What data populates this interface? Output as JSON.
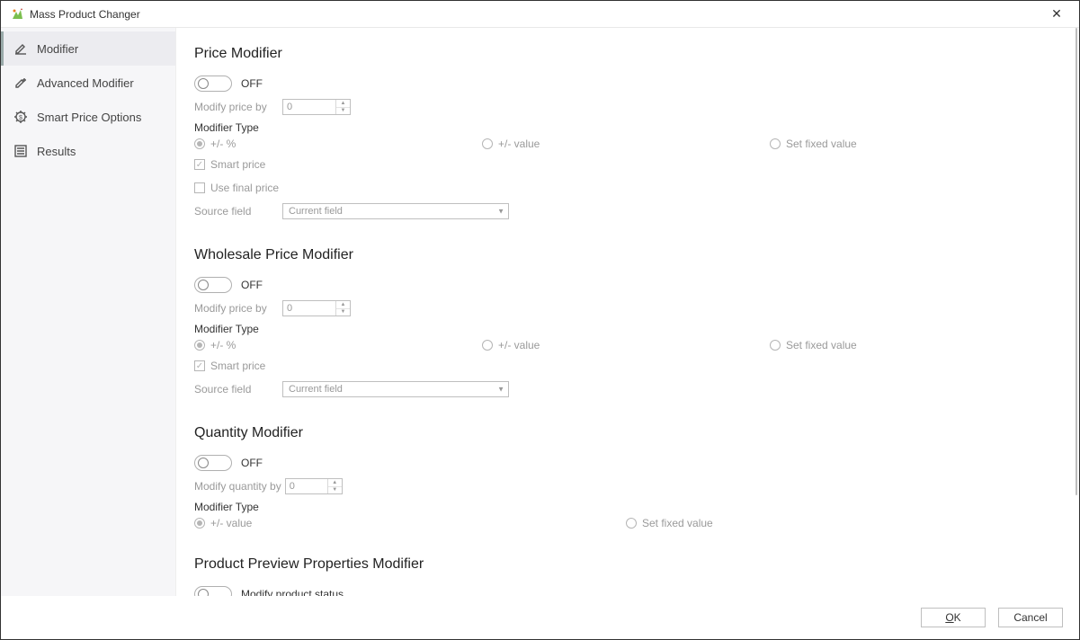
{
  "window": {
    "title": "Mass Product Changer"
  },
  "sidebar": {
    "items": [
      {
        "label": "Modifier"
      },
      {
        "label": "Advanced Modifier"
      },
      {
        "label": "Smart Price Options"
      },
      {
        "label": "Results"
      }
    ]
  },
  "price": {
    "heading": "Price Modifier",
    "toggle_label": "OFF",
    "modify_label": "Modify price by",
    "modify_value": "0",
    "type_label": "Modifier Type",
    "opt1": "+/- %",
    "opt2": "+/- value",
    "opt3": "Set fixed value",
    "smart": "Smart price",
    "final": "Use final price",
    "source_label": "Source field",
    "source_value": "Current field"
  },
  "wholesale": {
    "heading": "Wholesale Price Modifier",
    "toggle_label": "OFF",
    "modify_label": "Modify price by",
    "modify_value": "0",
    "type_label": "Modifier Type",
    "opt1": "+/- %",
    "opt2": "+/- value",
    "opt3": "Set fixed value",
    "smart": "Smart price",
    "source_label": "Source field",
    "source_value": "Current field"
  },
  "quantity": {
    "heading": "Quantity Modifier",
    "toggle_label": "OFF",
    "modify_label": "Modify quantity by",
    "modify_value": "0",
    "type_label": "Modifier Type",
    "opt1": "+/- value",
    "opt2": "Set fixed value"
  },
  "preview": {
    "heading": "Product Preview Properties Modifier",
    "toggle_label": "Modify product status"
  },
  "footer": {
    "ok": "OK",
    "cancel": "Cancel"
  }
}
